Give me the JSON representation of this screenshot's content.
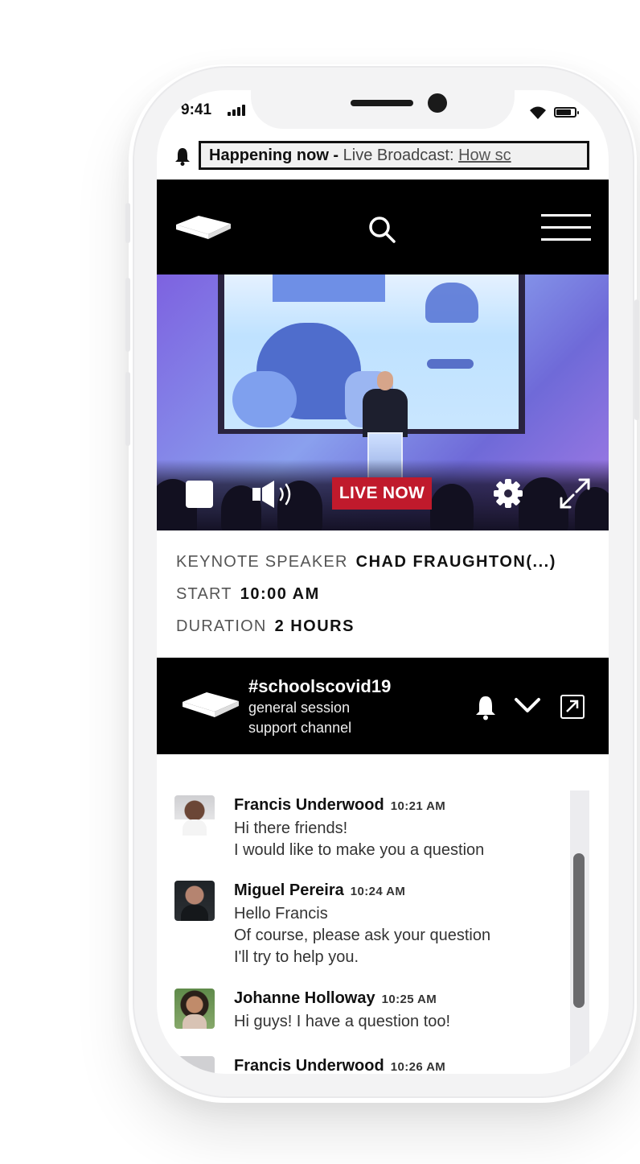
{
  "status_bar": {
    "time": "9:41"
  },
  "announcement": {
    "strong": "Happening now -",
    "text": " Live Broadcast: ",
    "link": "How sc"
  },
  "video": {
    "live_label": "LIVE NOW"
  },
  "event_info": {
    "speaker_label": "KEYNOTE SPEAKER",
    "speaker_value": "CHAD FRAUGHTON(...)",
    "start_label": "START",
    "start_value": "10:00 AM",
    "duration_label": "DURATION",
    "duration_value": "2 HOURS"
  },
  "channel": {
    "title": "#schoolscovid19",
    "subtitle_1": "general session",
    "subtitle_2": "support channel"
  },
  "messages": [
    {
      "name": "Francis Underwood",
      "time": "10:21 AM",
      "lines": [
        "Hi there friends!",
        "I would like to make you a question"
      ]
    },
    {
      "name": "Miguel Pereira",
      "time": "10:24 AM",
      "lines": [
        "Hello Francis",
        "Of course, please ask your question",
        "I'll try to help you."
      ]
    },
    {
      "name": "Johanne Holloway",
      "time": "10:25 AM",
      "lines": [
        "Hi guys! I have a question too!"
      ]
    },
    {
      "name": "Francis Underwood",
      "time": "10:26 AM",
      "lines": []
    }
  ],
  "colors": {
    "live_badge": "#c01a2c",
    "bar_background": "#000000",
    "video_tint": "#7d62e0"
  },
  "icons": [
    "bell-icon",
    "logo-icon",
    "search-icon",
    "menu-icon",
    "stop-icon",
    "volume-icon",
    "gear-icon",
    "expand-icon",
    "chevron-down-icon",
    "popout-icon"
  ]
}
